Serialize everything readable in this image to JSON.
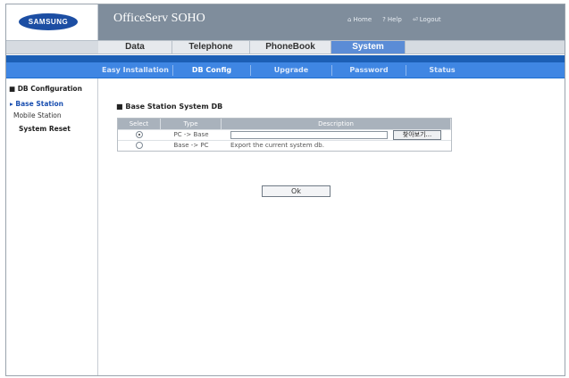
{
  "header": {
    "brand": "SAMSUNG",
    "app_title": "OfficeServ SOHO",
    "links": {
      "home": "Home",
      "help": "Help",
      "logout": "Logout"
    }
  },
  "tabs": [
    {
      "label": "Data",
      "active": false
    },
    {
      "label": "Telephone",
      "active": false
    },
    {
      "label": "PhoneBook",
      "active": false
    },
    {
      "label": "System",
      "active": true
    }
  ],
  "subnav": [
    {
      "label": "Easy Installation",
      "active": false
    },
    {
      "label": "DB Config",
      "active": true
    },
    {
      "label": "Upgrade",
      "active": false
    },
    {
      "label": "Password",
      "active": false
    },
    {
      "label": "Status",
      "active": false
    }
  ],
  "sidebar": {
    "section": "DB Configuration",
    "items": [
      {
        "label": "Base Station",
        "active": true
      },
      {
        "label": "Mobile Station",
        "active": false
      },
      {
        "label": "System Reset",
        "active": false
      }
    ]
  },
  "main": {
    "title": "Base Station System DB",
    "columns": [
      "Select",
      "Type",
      "Description"
    ],
    "rows": [
      {
        "selected": true,
        "type": "PC -> Base",
        "description": ""
      },
      {
        "selected": false,
        "type": "Base -> PC",
        "description": "Export the current system db."
      }
    ],
    "browse_label": "찾아보기...",
    "ok_label": "Ok"
  },
  "colors": {
    "header_bg": "#7f8d9c",
    "subnav_bg": "#3f86e3",
    "active_tab": "#5b8cd6",
    "brand_blue": "#1c4ea3"
  }
}
